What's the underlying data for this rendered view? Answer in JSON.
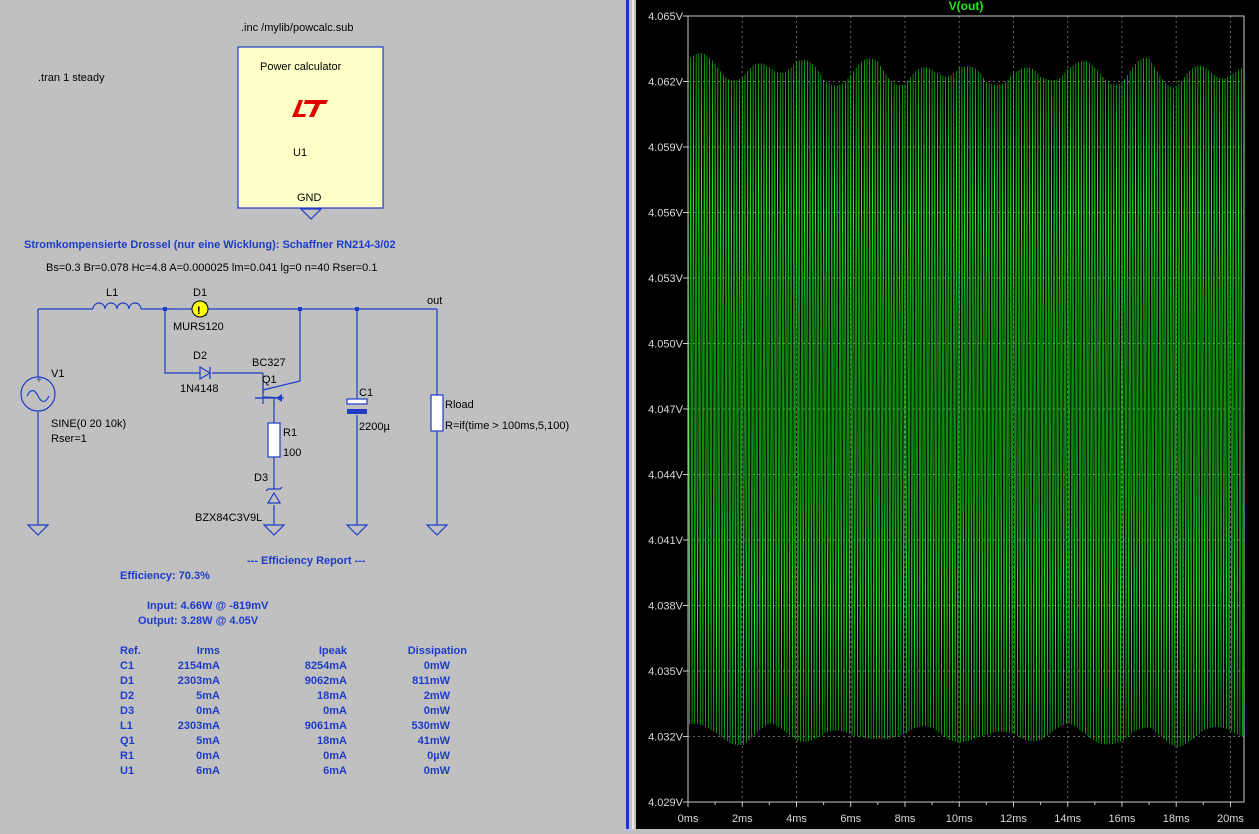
{
  "schematic": {
    "directives": {
      "include": ".inc /mylib/powcalc.sub",
      "tran": ".tran 1 steady"
    },
    "power_block": {
      "title": "Power calculator",
      "ref": "U1",
      "pin": "GND",
      "logo_icon": "linear-technology-logo-icon"
    },
    "inductor_comment": "Stromkompensierte Drossel (nur eine Wicklung): Schaffner RN214-3/02",
    "inductor_params": "Bs=0.3 Br=0.078 Hc=4.8 A=0.000025 lm=0.041 lg=0 n=40 Rser=0.1",
    "components": {
      "L1": "L1",
      "D1": "D1",
      "D1_model": "MURS120",
      "D2": "D2",
      "D2_model": "1N4148",
      "Q1": "Q1",
      "Q1_model": "BC327",
      "R1": "R1",
      "R1_value": "100",
      "D3": "D3",
      "D3_model": "BZX84C3V9L",
      "C1": "C1",
      "C1_value": "2200µ",
      "V1": "V1",
      "V1_value": "SINE(0 20 10k)",
      "V1_rser": "Rser=1",
      "Rload": "Rload",
      "Rload_value": "R=if(time > 100ms,5,100)",
      "net_out": "out"
    },
    "report": {
      "title": "--- Efficiency Report ---",
      "efficiency": "Efficiency: 70.3%",
      "input": "Input: 4.66W @ -819mV",
      "output": "Output: 3.28W @ 4.05V",
      "headers": [
        "Ref.",
        "Irms",
        "Ipeak",
        "Dissipation"
      ],
      "rows": [
        [
          "C1",
          "2154mA",
          "8254mA",
          "0mW"
        ],
        [
          "D1",
          "2303mA",
          "9062mA",
          "811mW"
        ],
        [
          "D2",
          "5mA",
          "18mA",
          "2mW"
        ],
        [
          "D3",
          "0mA",
          "0mA",
          "0mW"
        ],
        [
          "L1",
          "2303mA",
          "9061mA",
          "530mW"
        ],
        [
          "Q1",
          "5mA",
          "18mA",
          "41mW"
        ],
        [
          "R1",
          "0mA",
          "0mA",
          "0µW"
        ],
        [
          "U1",
          "6mA",
          "6mA",
          "0mW"
        ]
      ]
    }
  },
  "waveform": {
    "trace_label": "V(out)",
    "trace_color": "#1eea1e",
    "y_ticks": [
      "4.065V",
      "4.062V",
      "4.059V",
      "4.056V",
      "4.053V",
      "4.050V",
      "4.047V",
      "4.044V",
      "4.041V",
      "4.038V",
      "4.035V",
      "4.032V",
      "4.029V"
    ],
    "x_ticks": [
      "0ms",
      "2ms",
      "4ms",
      "6ms",
      "8ms",
      "10ms",
      "12ms",
      "14ms",
      "16ms",
      "18ms",
      "20ms"
    ]
  },
  "chart_data": {
    "type": "line",
    "title": "V(out)",
    "xlabel": "",
    "ylabel": "",
    "xlim": [
      0,
      20.5
    ],
    "ylim": [
      4.029,
      4.065
    ],
    "x_unit": "ms",
    "y_unit": "V",
    "grid": true,
    "series": [
      {
        "name": "V(out)",
        "ripple_frequency_khz": 10,
        "peak_envelope": [
          [
            0,
            4.063
          ],
          [
            1,
            4.0628
          ],
          [
            2,
            4.0622
          ],
          [
            3,
            4.0626
          ],
          [
            4,
            4.063
          ],
          [
            5,
            4.062
          ],
          [
            6,
            4.0624
          ],
          [
            7,
            4.0628
          ],
          [
            8,
            4.062
          ],
          [
            9,
            4.0624
          ],
          [
            10,
            4.0628
          ],
          [
            11,
            4.0618
          ],
          [
            12,
            4.0626
          ],
          [
            13,
            4.062
          ],
          [
            14,
            4.0628
          ],
          [
            15,
            4.0624
          ],
          [
            16,
            4.0622
          ],
          [
            17,
            4.0628
          ],
          [
            18,
            4.062
          ],
          [
            19,
            4.0624
          ],
          [
            20,
            4.0626
          ],
          [
            20.5,
            4.0624
          ]
        ],
        "trough_envelope": [
          [
            0,
            4.0323
          ],
          [
            1,
            4.0322
          ],
          [
            2,
            4.0318
          ],
          [
            3,
            4.0323
          ],
          [
            4,
            4.032
          ],
          [
            5,
            4.0322
          ],
          [
            6,
            4.0318
          ],
          [
            7,
            4.0322
          ],
          [
            8,
            4.032
          ],
          [
            9,
            4.0323
          ],
          [
            10,
            4.032
          ],
          [
            11,
            4.0318
          ],
          [
            12,
            4.0322
          ],
          [
            13,
            4.032
          ],
          [
            14,
            4.0323
          ],
          [
            15,
            4.032
          ],
          [
            16,
            4.0318
          ],
          [
            17,
            4.0322
          ],
          [
            18,
            4.0318
          ],
          [
            19,
            4.0321
          ],
          [
            20,
            4.0322
          ],
          [
            20.5,
            4.0322
          ]
        ]
      }
    ]
  }
}
